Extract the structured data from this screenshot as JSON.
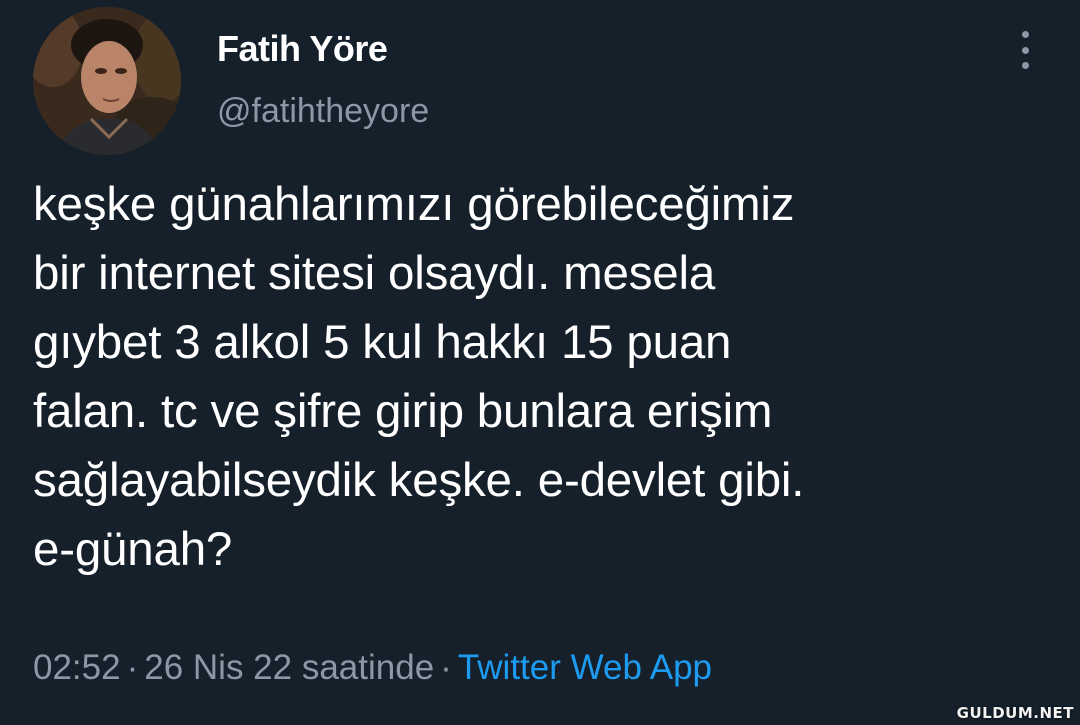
{
  "author": {
    "display_name": "Fatih Yöre",
    "handle": "@fatihtheyore"
  },
  "tweet": {
    "text": "keşke günahlarımızı görebileceğimiz\nbir internet sitesi olsaydı. mesela\ngıybet 3 alkol 5 kul hakkı 15 puan\nfalan. tc ve şifre girip bunlara erişim\nsağlayabilseydik keşke. e-devlet gibi.\ne-günah?"
  },
  "meta": {
    "time": "02:52",
    "date": "26 Nis 22 saatinde",
    "separator": "·",
    "source": "Twitter Web App"
  },
  "icons": {
    "more": "more-vertical-icon"
  },
  "colors": {
    "background": "#15202b",
    "text": "#ffffff",
    "muted": "#8b98a5",
    "link": "#1d9bf0"
  },
  "watermark": "GULDUM.NET"
}
